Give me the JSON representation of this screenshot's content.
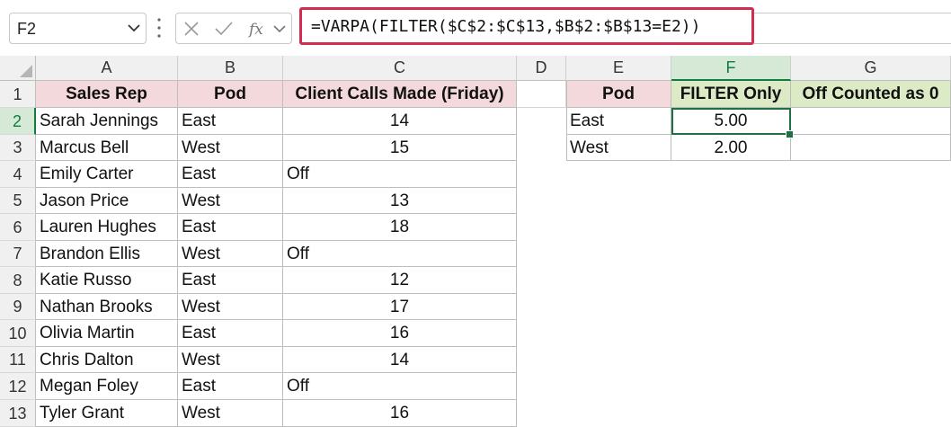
{
  "formula_bar": {
    "name_box": "F2",
    "formula": "=VARPA(FILTER($C$2:$C$13,$B$2:$B$13=E2))"
  },
  "columns": [
    "A",
    "B",
    "C",
    "D",
    "E",
    "F",
    "G"
  ],
  "rows": [
    "1",
    "2",
    "3",
    "4",
    "5",
    "6",
    "7",
    "8",
    "9",
    "10",
    "11",
    "12",
    "13"
  ],
  "table": {
    "headers": [
      "Sales Rep",
      "Pod",
      "Client Calls Made (Friday)"
    ],
    "rows": [
      [
        "Sarah Jennings",
        "East",
        "14"
      ],
      [
        "Marcus Bell",
        "West",
        "15"
      ],
      [
        "Emily Carter",
        "East",
        "Off"
      ],
      [
        "Jason Price",
        "West",
        "13"
      ],
      [
        "Lauren Hughes",
        "East",
        "18"
      ],
      [
        "Brandon Ellis",
        "West",
        "Off"
      ],
      [
        "Katie Russo",
        "East",
        "12"
      ],
      [
        "Nathan Brooks",
        "West",
        "17"
      ],
      [
        "Olivia Martin",
        "East",
        "16"
      ],
      [
        "Chris Dalton",
        "West",
        "14"
      ],
      [
        "Megan Foley",
        "East",
        "Off"
      ],
      [
        "Tyler Grant",
        "West",
        "16"
      ]
    ]
  },
  "summary": {
    "headers": [
      "Pod",
      "FILTER Only",
      "Off Counted as 0"
    ],
    "rows": [
      [
        "East",
        "5.00",
        ""
      ],
      [
        "West",
        "2.00",
        ""
      ]
    ]
  },
  "colors": {
    "formula_highlight": "#d22c50",
    "header_pink": "#f4d9dc",
    "header_green": "#dcebc6",
    "selection_green": "#1e7145"
  }
}
